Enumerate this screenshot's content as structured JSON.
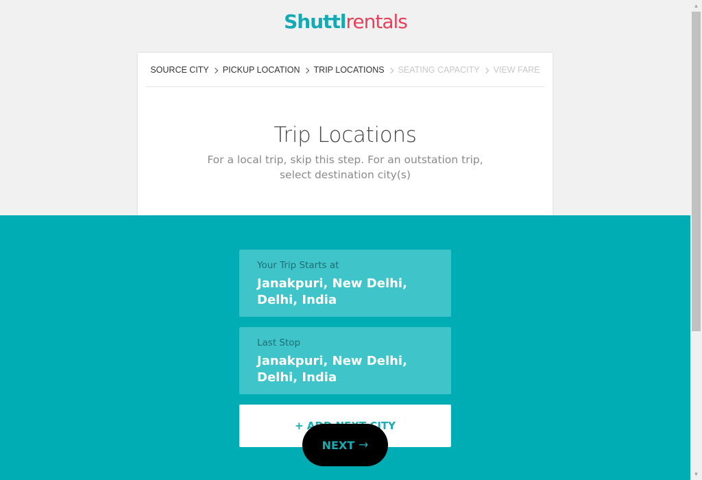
{
  "brand": {
    "part1": "Shuttl",
    "part2": "rentals",
    "color1": "#14aab3",
    "color2": "#e8405a"
  },
  "breadcrumb": {
    "items": [
      {
        "label": "SOURCE CITY",
        "enabled": true
      },
      {
        "label": "PICKUP LOCATION",
        "enabled": true
      },
      {
        "label": "TRIP LOCATIONS",
        "enabled": true
      },
      {
        "label": "SEATING CAPACITY",
        "enabled": false
      },
      {
        "label": "VIEW FARE",
        "enabled": false
      }
    ]
  },
  "step": {
    "title": "Trip Locations",
    "subtitle": "For a local trip, skip this step. For an outstation trip, select destination city(s)"
  },
  "trip": {
    "start_label": "Your Trip Starts at",
    "start_value": "Janakpuri, New Delhi, Delhi, India",
    "last_label": "Last Stop",
    "last_value": "Janakpuri, New Delhi, Delhi, India"
  },
  "actions": {
    "add_city": "+ ADD NEXT CITY",
    "next": "NEXT",
    "next_icon": "arrow-right-icon"
  },
  "colors": {
    "teal": "#00adb5",
    "tile": "#3ec4c9"
  }
}
